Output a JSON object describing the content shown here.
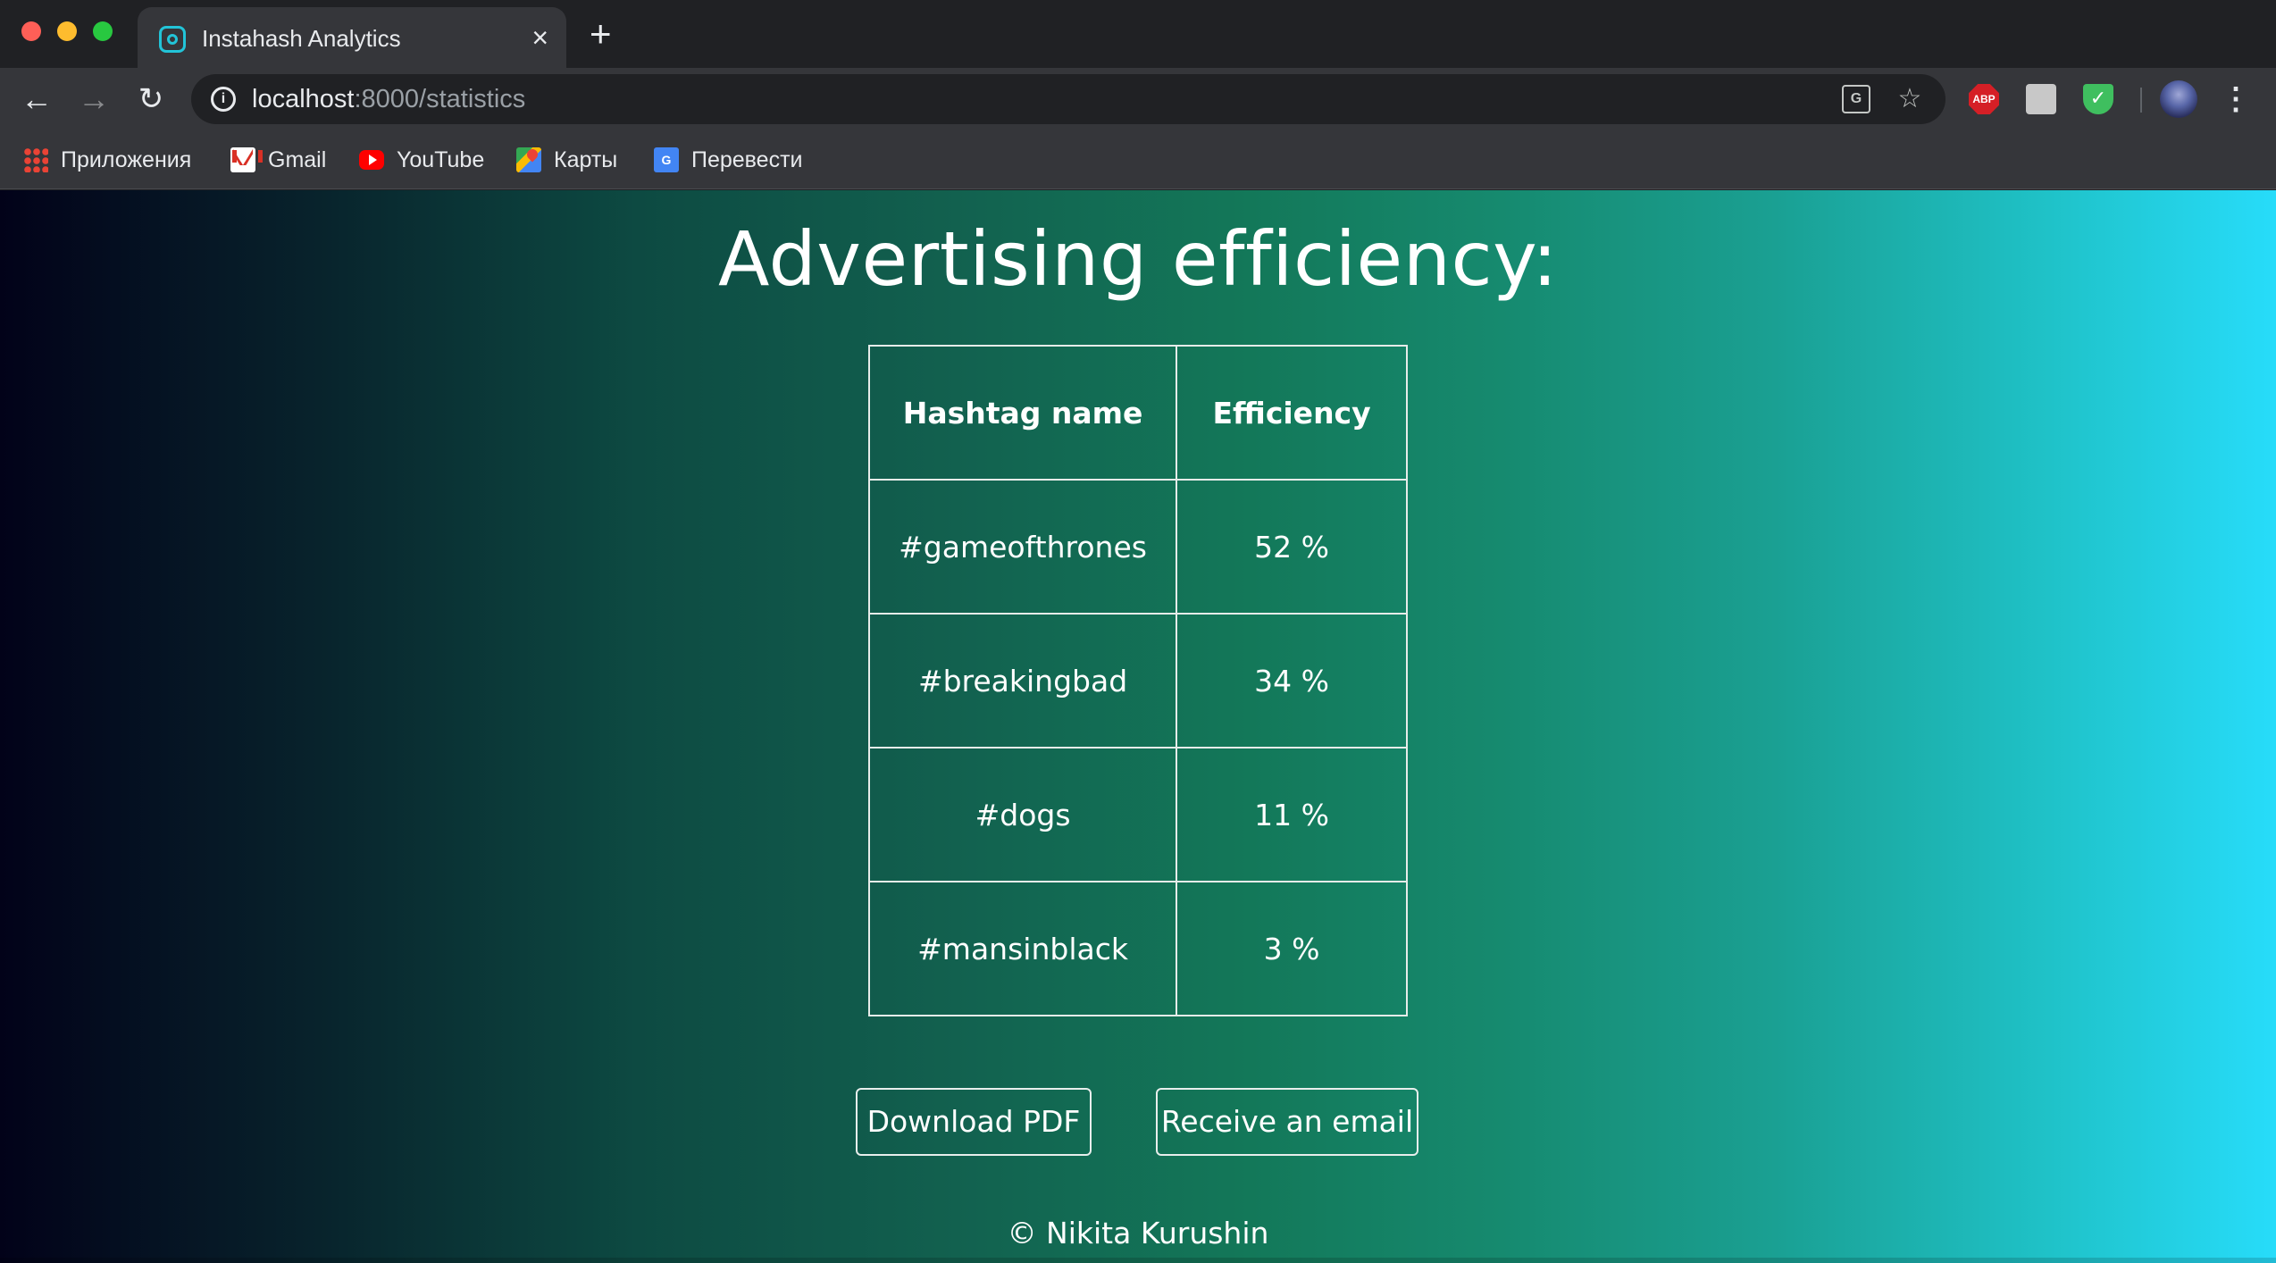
{
  "browser": {
    "tab": {
      "title": "Instahash Analytics",
      "close": "×"
    },
    "new_tab": "+",
    "nav": {
      "back": "←",
      "forward": "→",
      "reload": "↻"
    },
    "address": {
      "host": "localhost",
      "path": ":8000/statistics"
    },
    "bookmarks": [
      {
        "label": "Приложения",
        "icon": "apps-icon"
      },
      {
        "label": "Gmail",
        "icon": "gmail-icon"
      },
      {
        "label": "YouTube",
        "icon": "youtube-icon"
      },
      {
        "label": "Карты",
        "icon": "maps-icon"
      },
      {
        "label": "Перевести",
        "icon": "translate-icon"
      }
    ],
    "extensions": {
      "abp": "ABP"
    }
  },
  "page": {
    "title": "Advertising efficiency:",
    "table": {
      "headers": [
        "Hashtag name",
        "Efficiency"
      ],
      "rows": [
        {
          "name": "#gameofthrones",
          "efficiency": "52 %"
        },
        {
          "name": "#breakingbad",
          "efficiency": "34 %"
        },
        {
          "name": "#dogs",
          "efficiency": "11 %"
        },
        {
          "name": "#mansinblack",
          "efficiency": "3 %"
        }
      ]
    },
    "buttons": {
      "pdf": "Download PDF",
      "email": "Receive an email"
    },
    "footer": "© Nikita Kurushin"
  },
  "colors": {
    "gradient_start": "#020219",
    "gradient_mid": "#137859",
    "gradient_end": "#27dcfa",
    "tab_icon": "#22c4d8"
  }
}
